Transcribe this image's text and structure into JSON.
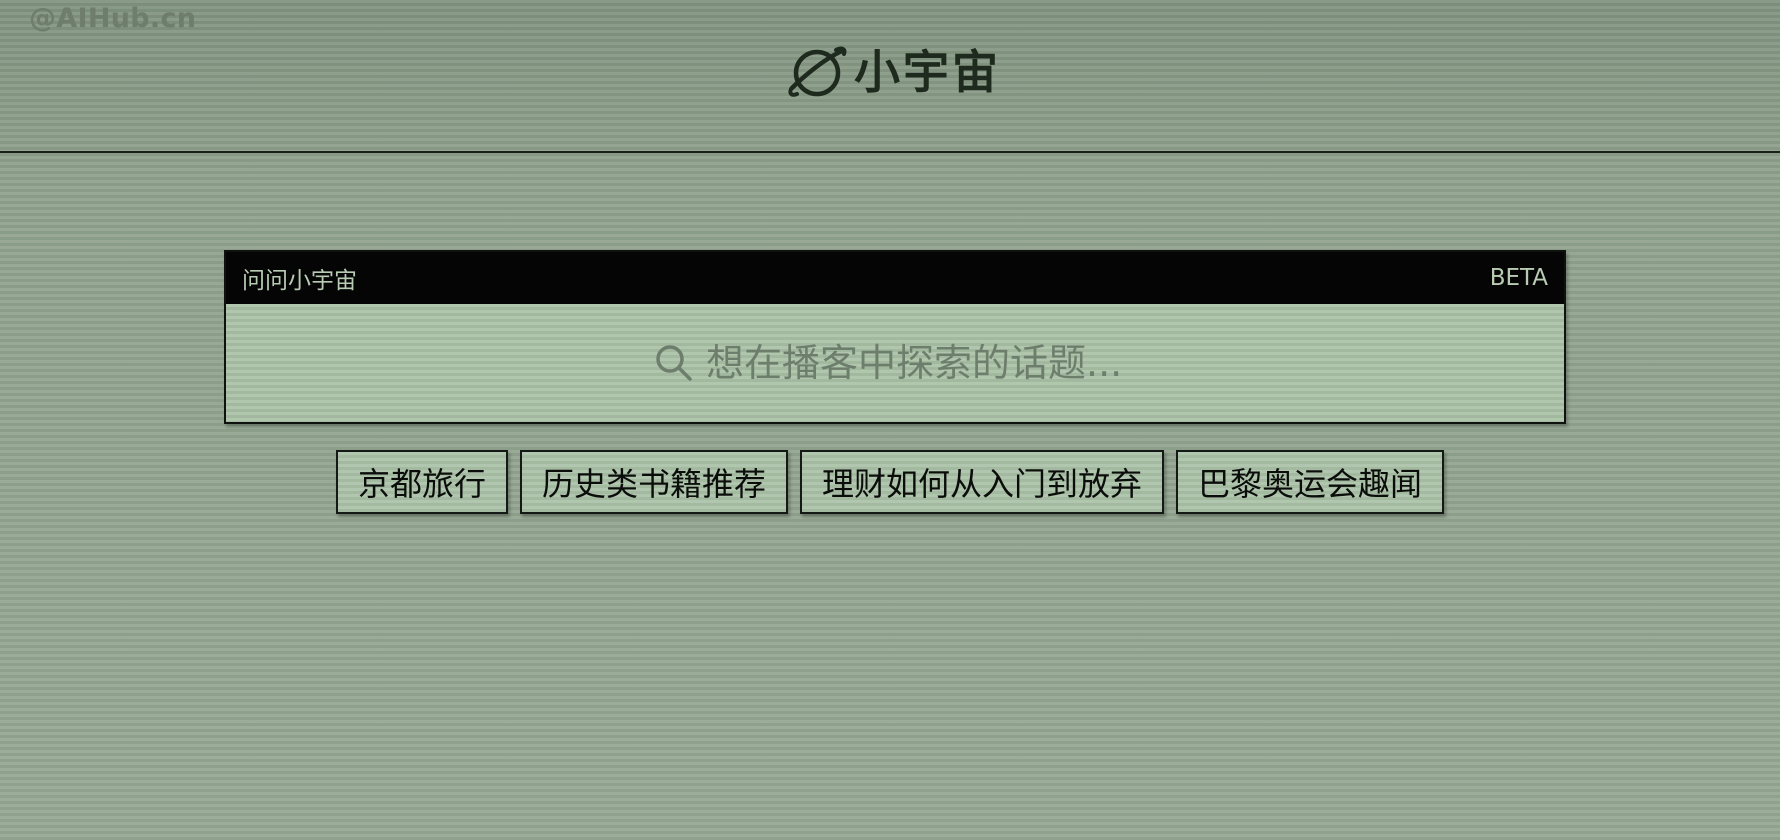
{
  "watermark": "@AIHub.cn",
  "brand": {
    "logo_icon": "planet-icon",
    "name": "小宇宙"
  },
  "search_card": {
    "title": "问问小宇宙",
    "badge": "BETA",
    "search_icon": "search-icon",
    "placeholder": "想在播客中探索的话题...",
    "value": ""
  },
  "suggestions": [
    {
      "label": "京都旅行"
    },
    {
      "label": "历史类书籍推荐"
    },
    {
      "label": "理财如何从入门到放弃"
    },
    {
      "label": "巴黎奥运会趣闻"
    }
  ],
  "colors": {
    "background": "#93a690",
    "card_header": "#050505",
    "card_body": "#a7bfa4",
    "chip": "#a8c0a5",
    "text_dark": "#1e2a1e"
  }
}
